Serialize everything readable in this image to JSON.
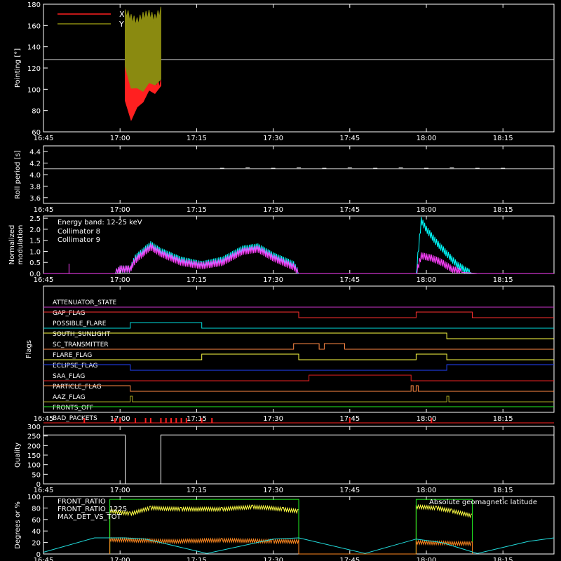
{
  "time_ticks": [
    "16:45",
    "17:00",
    "17:15",
    "17:30",
    "17:45",
    "18:00",
    "18:15"
  ],
  "chart_data": [
    {
      "type": "line",
      "panel": "pointing",
      "ylabel": "Pointing [°]",
      "ylim": [
        60,
        180
      ],
      "yticks": [
        "60",
        "80",
        "100",
        "120",
        "140",
        "160",
        "180"
      ],
      "xlim": [
        "16:45",
        "18:25"
      ],
      "legend_position": "top-left",
      "reference_line": 128,
      "series": [
        {
          "name": "X",
          "color": "#ff2020",
          "t_start": "17:01",
          "t_end": "17:08",
          "low": [
            88,
            75,
            82,
            92,
            98,
            100,
            102
          ],
          "high": [
            125,
            120,
            118,
            112,
            110,
            108,
            106
          ]
        },
        {
          "name": "Y",
          "color": "#8a8a10",
          "t_start": "17:01",
          "t_end": "17:08",
          "low": [
            120,
            105,
            100,
            102,
            105,
            108,
            108
          ],
          "high": [
            175,
            168,
            165,
            170,
            172,
            168,
            175
          ]
        }
      ]
    },
    {
      "type": "line",
      "panel": "roll",
      "ylabel": "Roll period [s]",
      "ylim": [
        3.5,
        4.5
      ],
      "yticks": [
        "3.6",
        "3.8",
        "4.0",
        "4.2",
        "4.4"
      ],
      "reference_line": 4.1,
      "series": [
        {
          "name": "roll period",
          "color": "#ffffff",
          "points": [
            [
              "17:20",
              4.11
            ],
            [
              "17:25",
              4.12
            ],
            [
              "17:30",
              4.11
            ],
            [
              "17:35",
              4.12
            ],
            [
              "17:40",
              4.11
            ],
            [
              "17:45",
              4.12
            ],
            [
              "17:50",
              4.11
            ],
            [
              "17:55",
              4.12
            ],
            [
              "18:00",
              4.11
            ],
            [
              "18:05",
              4.12
            ],
            [
              "18:10",
              4.11
            ],
            [
              "18:15",
              4.11
            ]
          ]
        }
      ]
    },
    {
      "type": "line",
      "panel": "modulation",
      "ylabel": "Normalized modulation",
      "ylim": [
        0,
        2.6
      ],
      "yticks": [
        "0.0",
        "0.5",
        "1.0",
        "1.5",
        "2.0",
        "2.5"
      ],
      "legend_title": "Energy band: 12-25 keV",
      "series": [
        {
          "name": "Collimator 8",
          "color": "#00ffff",
          "points": [
            [
              "16:50",
              0.0
            ],
            [
              "16:59",
              0.0
            ],
            [
              "17:00",
              0.2
            ],
            [
              "17:02",
              0.2
            ],
            [
              "17:03",
              0.7
            ],
            [
              "17:06",
              1.3
            ],
            [
              "17:08",
              1.0
            ],
            [
              "17:12",
              0.6
            ],
            [
              "17:16",
              0.4
            ],
            [
              "17:20",
              0.6
            ],
            [
              "17:24",
              1.1
            ],
            [
              "17:27",
              1.2
            ],
            [
              "17:30",
              0.8
            ],
            [
              "17:34",
              0.4
            ],
            [
              "17:35",
              0.0
            ],
            [
              "17:58",
              0.0
            ],
            [
              "17:59",
              2.4
            ],
            [
              "18:00",
              2.0
            ],
            [
              "18:02",
              1.4
            ],
            [
              "18:04",
              0.9
            ],
            [
              "18:06",
              0.4
            ],
            [
              "18:08",
              0.1
            ],
            [
              "18:09",
              0.0
            ]
          ]
        },
        {
          "name": "Collimator 9",
          "color": "#ff40ff",
          "points": [
            [
              "16:45",
              0.0
            ],
            [
              "16:50",
              0.0
            ],
            [
              "16:59",
              0.0
            ],
            [
              "17:00",
              0.2
            ],
            [
              "17:02",
              0.2
            ],
            [
              "17:03",
              0.6
            ],
            [
              "17:06",
              1.2
            ],
            [
              "17:08",
              0.9
            ],
            [
              "17:12",
              0.5
            ],
            [
              "17:16",
              0.35
            ],
            [
              "17:20",
              0.5
            ],
            [
              "17:24",
              1.0
            ],
            [
              "17:27",
              1.1
            ],
            [
              "17:30",
              0.7
            ],
            [
              "17:34",
              0.3
            ],
            [
              "17:35",
              0.0
            ],
            [
              "17:58",
              0.0
            ],
            [
              "17:59",
              0.8
            ],
            [
              "18:01",
              0.7
            ],
            [
              "18:03",
              0.5
            ],
            [
              "18:05",
              0.2
            ],
            [
              "18:07",
              0.05
            ],
            [
              "18:10",
              0.0
            ],
            [
              "18:25",
              0.0
            ]
          ]
        }
      ]
    },
    {
      "type": "line",
      "panel": "flags",
      "ylabel": "Flags",
      "flags": [
        {
          "name": "ATTENUATOR_STATE",
          "color": "#cc33cc",
          "high": []
        },
        {
          "name": "GAP_FLAG",
          "color": "#ff3030",
          "high": [
            [
              "16:45",
              "17:35"
            ],
            [
              "17:58",
              "18:09"
            ]
          ]
        },
        {
          "name": "POSSIBLE_FLARE",
          "color": "#00dddd",
          "high": [
            [
              "17:02",
              "17:16"
            ]
          ]
        },
        {
          "name": "SOUTH_SUNLIGHT",
          "color": "#ffff44",
          "high": [
            [
              "16:45",
              "18:04"
            ]
          ]
        },
        {
          "name": "SC_TRANSMITTER",
          "color": "#ff8844",
          "high": [
            [
              "17:34",
              "17:39"
            ],
            [
              "17:40",
              "17:44"
            ]
          ]
        },
        {
          "name": "FLARE_FLAG",
          "color": "#ffff44",
          "high": [
            [
              "17:16",
              "17:35"
            ],
            [
              "17:58",
              "18:04"
            ]
          ]
        },
        {
          "name": "ECLIPSE_FLAG",
          "color": "#2244ff",
          "high": [
            [
              "16:45",
              "17:02"
            ],
            [
              "18:04",
              "18:25"
            ]
          ]
        },
        {
          "name": "SAA_FLAG",
          "color": "#ee2222",
          "high": [
            [
              "17:37",
              "17:57"
            ]
          ]
        },
        {
          "name": "PARTICLE_FLAG",
          "color": "#ff8844",
          "high": [
            [
              "16:45",
              "17:02"
            ],
            [
              "17:57",
              "17:57"
            ],
            [
              "17:58",
              "17:58"
            ]
          ]
        },
        {
          "name": "AAZ_FLAG",
          "color": "#aaaa22",
          "high": [
            [
              "17:02",
              "17:02"
            ],
            [
              "18:04",
              "18:04"
            ]
          ]
        },
        {
          "name": "FRONTS_OFF",
          "color": "#22ee22",
          "high": [
            [
              "16:45",
              "18:25"
            ]
          ]
        },
        {
          "name": "BAD_PACKETS",
          "color": "#ff2222",
          "ticks": [
            "16:53",
            "16:59",
            "17:00",
            "17:03",
            "17:05",
            "17:06",
            "17:08",
            "17:09",
            "17:10",
            "17:11",
            "17:12",
            "17:13",
            "17:16",
            "17:18",
            "17:45",
            "18:01"
          ]
        }
      ]
    },
    {
      "type": "line",
      "panel": "quality",
      "ylabel": "Quality",
      "ylim": [
        0,
        300
      ],
      "yticks": [
        "0",
        "50",
        "100",
        "150",
        "200",
        "250",
        "300"
      ],
      "series": [
        {
          "name": "quality",
          "color": "#ffffff",
          "points": [
            [
              "16:45",
              255
            ],
            [
              "17:01",
              255
            ],
            [
              "17:01",
              0
            ],
            [
              "17:08",
              0
            ],
            [
              "17:08",
              255
            ],
            [
              "18:25",
              255
            ]
          ]
        }
      ]
    },
    {
      "type": "line",
      "panel": "ratios",
      "ylabel": "Degrees or %",
      "ylim": [
        0,
        100
      ],
      "yticks": [
        "0",
        "20",
        "40",
        "60",
        "80",
        "100"
      ],
      "annotation": "Absolute geomagnetic latitude",
      "series": [
        {
          "name": "FRONT_RATIO",
          "color": "#ffff44",
          "points": [
            [
              "16:58",
              0
            ],
            [
              "16:58",
              75
            ],
            [
              "17:02",
              70
            ],
            [
              "17:06",
              80
            ],
            [
              "17:12",
              78
            ],
            [
              "17:20",
              78
            ],
            [
              "17:26",
              82
            ],
            [
              "17:32",
              78
            ],
            [
              "17:35",
              74
            ],
            [
              "17:35",
              0
            ],
            [
              "17:58",
              0
            ],
            [
              "17:58",
              82
            ],
            [
              "18:02",
              80
            ],
            [
              "18:05",
              75
            ],
            [
              "18:09",
              66
            ],
            [
              "18:09",
              0
            ]
          ]
        },
        {
          "name": "FRONT_RATIO_1225",
          "color": "#22ee22",
          "points": [
            [
              "16:58",
              0
            ],
            [
              "16:58",
              95
            ],
            [
              "17:35",
              95
            ],
            [
              "17:35",
              0
            ],
            [
              "17:58",
              0
            ],
            [
              "17:58",
              95
            ],
            [
              "18:09",
              95
            ],
            [
              "18:09",
              0
            ]
          ]
        },
        {
          "name": "MAX_DET_VS_TOT",
          "color": "#ff8820",
          "points": [
            [
              "16:58",
              0
            ],
            [
              "16:58",
              25
            ],
            [
              "17:10",
              22
            ],
            [
              "17:20",
              24
            ],
            [
              "17:30",
              22
            ],
            [
              "17:35",
              22
            ],
            [
              "17:35",
              0
            ],
            [
              "17:58",
              0
            ],
            [
              "17:58",
              20
            ],
            [
              "18:09",
              18
            ],
            [
              "18:09",
              0
            ]
          ]
        },
        {
          "name": "Absolute geomagnetic latitude",
          "color": "#22dddd",
          "points": [
            [
              "16:45",
              3
            ],
            [
              "16:55",
              28
            ],
            [
              "17:01",
              28
            ],
            [
              "17:05",
              26
            ],
            [
              "17:17",
              1
            ],
            [
              "17:30",
              26
            ],
            [
              "17:35",
              28
            ],
            [
              "17:48",
              1
            ],
            [
              "17:58",
              26
            ],
            [
              "18:03",
              20
            ],
            [
              "18:10",
              1
            ],
            [
              "18:20",
              22
            ],
            [
              "18:25",
              28
            ]
          ]
        }
      ]
    }
  ]
}
